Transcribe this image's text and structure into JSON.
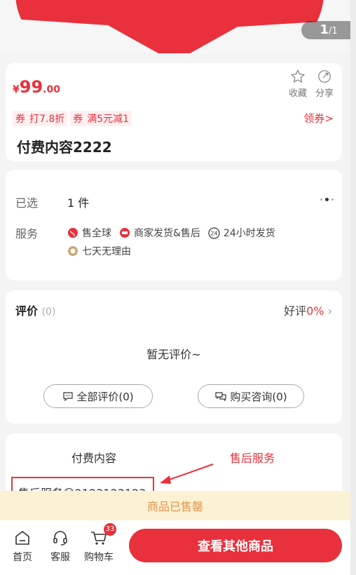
{
  "hero": {
    "page_index": "1",
    "page_total": "/1"
  },
  "product": {
    "price_symbol": "¥",
    "price_int": "99",
    "price_dec": ".00",
    "favorite_label": "收藏",
    "share_label": "分享",
    "coupons": [
      {
        "tag": "券",
        "text": "打7.8折"
      },
      {
        "tag": "券",
        "text": "满5元减1"
      }
    ],
    "get_coupon_label": "领券>",
    "title": "付费内容2222"
  },
  "selection": {
    "selected_label": "已选",
    "selected_value": "1 件",
    "service_label": "服务",
    "services_line1": [
      {
        "icon": "globe-icon",
        "text": "售全球"
      },
      {
        "icon": "merchant-icon",
        "text": "商家发货&售后"
      },
      {
        "icon": "24h-icon",
        "text": "24小时发货"
      }
    ],
    "services_line2": [
      {
        "icon": "seven-day-icon",
        "text": "七天无理由"
      }
    ]
  },
  "reviews": {
    "title": "评价",
    "count": "(0)",
    "good_rate_label": "好评",
    "good_rate_value": "0%",
    "empty_text": "暂无评价~",
    "all_reviews_label": "全部评价(0)",
    "consult_label": "购买咨询(0)"
  },
  "details": {
    "tab_content": "付费内容",
    "tab_after_sales": "售后服务",
    "after_sales_text": "售后服务😊2123123123"
  },
  "notice": {
    "sold_out": "商品已售罄"
  },
  "bottom": {
    "home_label": "首页",
    "service_label": "客服",
    "cart_label": "购物车",
    "cart_count": "33",
    "cta_label": "查看其他商品"
  },
  "colors": {
    "accent": "#e8313c",
    "notice_bg": "#fbf2d4",
    "notice_text": "#e8914a"
  }
}
